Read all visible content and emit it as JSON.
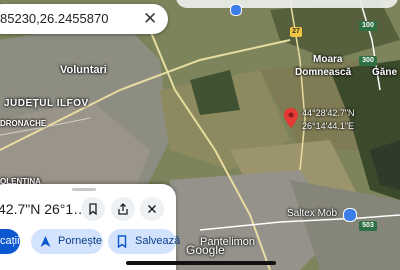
{
  "search": {
    "query": "85230,26.2455870",
    "close_glyph": "✕"
  },
  "place_labels": {
    "voluntari": "Voluntari",
    "judetul_ilfov": "JUDEȚUL ILFOV",
    "dronache": "DRONACHE",
    "olentina": "OLENTINA",
    "moara": "Moara",
    "domneasca": "Domnească",
    "gane": "Găne",
    "saltex": "Saltex Mob",
    "pantelimon": "Pantelimon"
  },
  "pin": {
    "lat_label": "44°28'42.7\"N",
    "lon_label": "26°14'44.1\"E",
    "color": "#e53935"
  },
  "road_badges": {
    "r27": "27",
    "r100": "100",
    "r300": "300",
    "r503": "503"
  },
  "attribution": "Google",
  "sheet": {
    "title": "42.7\"N 26°1…",
    "buttons": {
      "save_icon": "bookmark-icon",
      "share_icon": "share-icon",
      "close_icon": "close-icon"
    }
  },
  "actions": {
    "directions_label": "cații",
    "start_label": "Pornește",
    "save_label": "Salvează"
  },
  "colors": {
    "accent": "#0b57d0",
    "chip_bg": "#d3e3fd",
    "pin": "#e53935"
  }
}
